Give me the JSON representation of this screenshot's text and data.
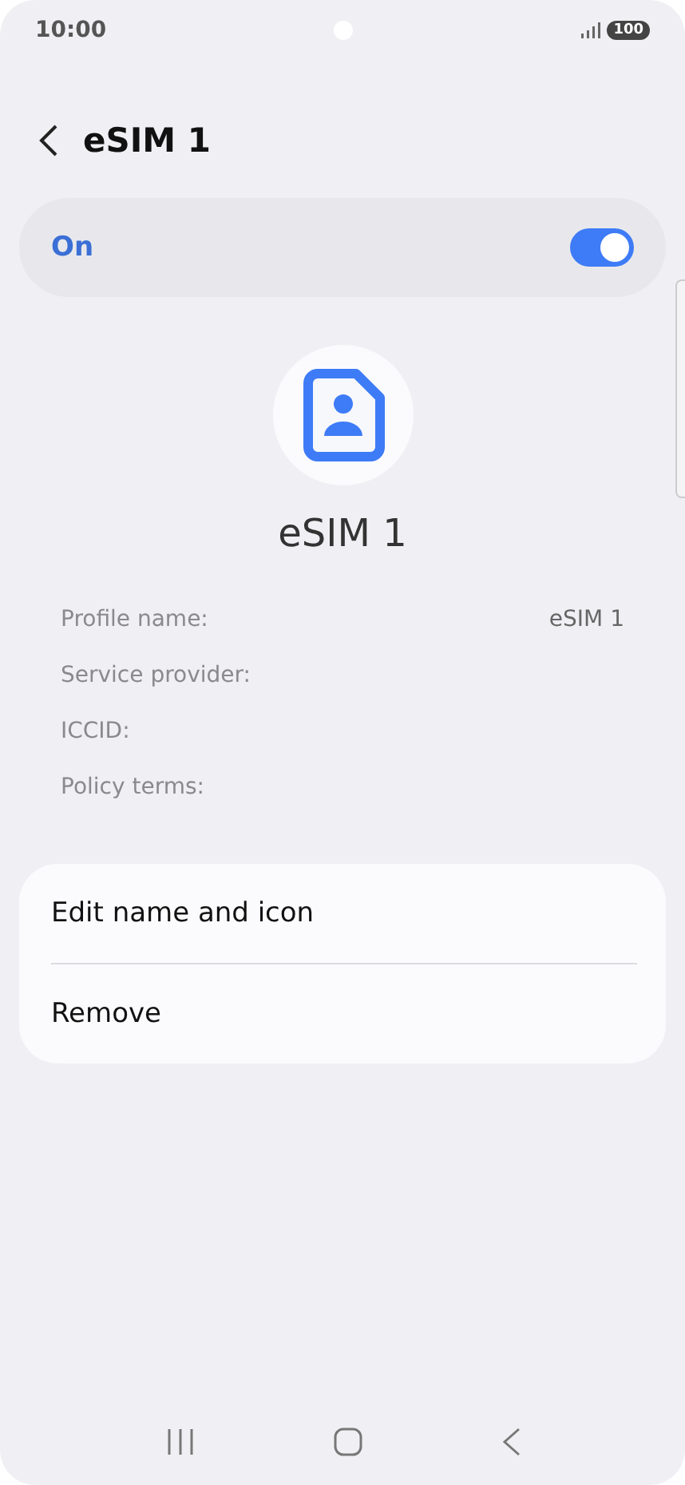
{
  "status_bar": {
    "time": "10:00",
    "battery": "100"
  },
  "header": {
    "title": "eSIM 1"
  },
  "toggle": {
    "label": "On",
    "on": true
  },
  "profile": {
    "name": "eSIM 1"
  },
  "details": [
    {
      "label": "Profile name:",
      "value": "eSIM 1"
    },
    {
      "label": "Service provider:"
    },
    {
      "label": "ICCID:"
    },
    {
      "label": "Policy terms:"
    }
  ],
  "actions": [
    "Edit name and icon",
    "Remove"
  ]
}
